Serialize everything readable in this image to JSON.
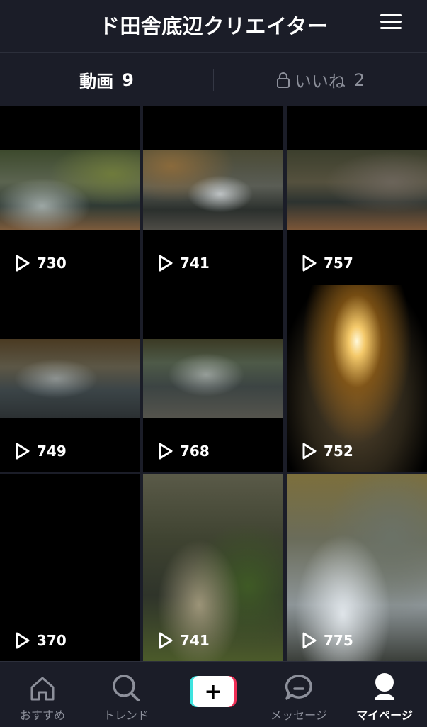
{
  "header": {
    "title": "ド田舎底辺クリエイター",
    "menu_icon": "hamburger-menu-icon"
  },
  "tabs": [
    {
      "label": "動画",
      "count": "9",
      "active": true
    },
    {
      "label": "いいね",
      "count": "2",
      "active": false,
      "icon": "lock-icon"
    }
  ],
  "accent_color": "#f5c542",
  "videos": [
    {
      "plays": "730",
      "thumb": "stream-rocks"
    },
    {
      "plays": "741",
      "thumb": "stream-cascade"
    },
    {
      "plays": "757",
      "thumb": "stream-channel-leaves"
    },
    {
      "plays": "749",
      "thumb": "stream-forest"
    },
    {
      "plays": "768",
      "thumb": "stream-rapids"
    },
    {
      "plays": "752",
      "thumb": "candle"
    },
    {
      "plays": "370",
      "thumb": "black"
    },
    {
      "plays": "741",
      "thumb": "water-channel"
    },
    {
      "plays": "775",
      "thumb": "waterfall"
    }
  ],
  "bottom_nav": [
    {
      "label": "おすすめ",
      "icon": "home-icon"
    },
    {
      "label": "トレンド",
      "icon": "search-icon"
    },
    {
      "label": "",
      "icon": "plus-icon"
    },
    {
      "label": "メッセージ",
      "icon": "message-icon"
    },
    {
      "label": "マイページ",
      "icon": "profile-icon",
      "active": true
    }
  ]
}
